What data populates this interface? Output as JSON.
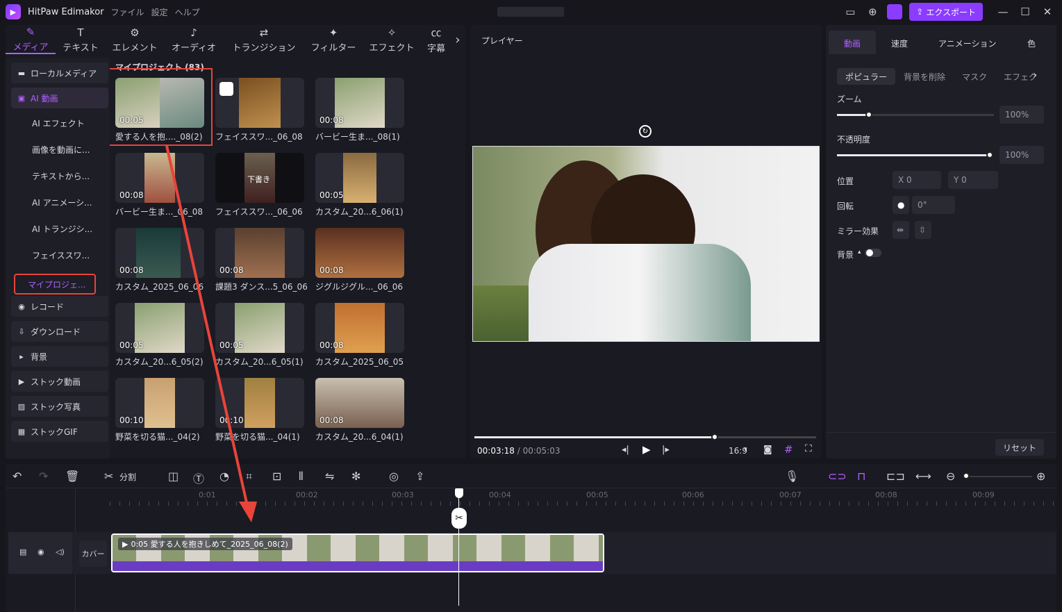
{
  "app": {
    "name": "HitPaw Edimakor",
    "menus": [
      "ファイル",
      "設定",
      "ヘルプ"
    ],
    "export_label": "エクスポート"
  },
  "tabs": [
    {
      "label": "メディア",
      "icon": "media-icon"
    },
    {
      "label": "テキスト",
      "icon": "text-icon"
    },
    {
      "label": "エレメント",
      "icon": "element-icon"
    },
    {
      "label": "オーディオ",
      "icon": "audio-icon"
    },
    {
      "label": "トランジション",
      "icon": "transition-icon"
    },
    {
      "label": "フィルター",
      "icon": "filter-icon"
    },
    {
      "label": "エフェクト",
      "icon": "effect-icon"
    },
    {
      "label": "字幕",
      "icon": "subtitle-icon"
    }
  ],
  "sidebar": {
    "items": [
      {
        "label": "ローカルメディア"
      },
      {
        "label": "AI 動画"
      },
      {
        "label": "AI エフェクト"
      },
      {
        "label": "画像を動画に..."
      },
      {
        "label": "テキストから..."
      },
      {
        "label": "AI アニメーシ..."
      },
      {
        "label": "AI トランジシ..."
      },
      {
        "label": "フェイススワ..."
      },
      {
        "label": "マイプロジェ..."
      },
      {
        "label": "レコード"
      },
      {
        "label": "ダウンロード"
      },
      {
        "label": "背景"
      },
      {
        "label": "ストック動画"
      },
      {
        "label": "ストック写真"
      },
      {
        "label": "ストックGIF"
      }
    ]
  },
  "grid": {
    "title": "マイプロジェクト (83)",
    "items": [
      {
        "duration": "00:05",
        "caption": "愛する人を抱...._08(2)"
      },
      {
        "duration": "",
        "caption": "フェイススワ..._06_08"
      },
      {
        "duration": "00:08",
        "caption": "バービー生ま..._08(1)"
      },
      {
        "duration": "00:08",
        "caption": "バービー生ま..._06_08"
      },
      {
        "duration": "",
        "caption": "フェイススワ..._06_06",
        "overlay": "下書き"
      },
      {
        "duration": "00:05",
        "caption": "カスタム_20...6_06(1)"
      },
      {
        "duration": "00:08",
        "caption": "カスタム_2025_06_06"
      },
      {
        "duration": "00:08",
        "caption": "課題3 ダンス...5_06_06"
      },
      {
        "duration": "00:08",
        "caption": "ジグルジグル..._06_06"
      },
      {
        "duration": "00:05",
        "caption": "カスタム_20...6_05(2)"
      },
      {
        "duration": "00:05",
        "caption": "カスタム_20...6_05(1)"
      },
      {
        "duration": "00:08",
        "caption": "カスタム_2025_06_05"
      },
      {
        "duration": "00:10",
        "caption": "野菜を切る猫..._04(2)"
      },
      {
        "duration": "00:10",
        "caption": "野菜を切る猫..._04(1)"
      },
      {
        "duration": "00:08",
        "caption": "カスタム_20...6_04(1)"
      }
    ]
  },
  "player": {
    "title": "プレイヤー",
    "time_current": "00:03:18",
    "time_total": "00:05:03",
    "progress": 0.655,
    "aspect": "16:9"
  },
  "props": {
    "tabs": [
      "動画",
      "速度",
      "アニメーション",
      "色"
    ],
    "subtabs": [
      "ポピュラー",
      "背景を削除",
      "マスク",
      "エフェク"
    ],
    "zoom_label": "ズーム",
    "zoom_value": "100%",
    "opacity_label": "不透明度",
    "opacity_value": "100%",
    "position_label": "位置",
    "pos_x": "X  0",
    "pos_y": "Y  0",
    "rotate_label": "回転",
    "rotate_value": "0°",
    "mirror_label": "ミラー効果",
    "bg_label": "背景",
    "reset_label": "リセット"
  },
  "timeline": {
    "split_label": "分割",
    "ruler": [
      "0:01",
      "00:02",
      "00:03",
      "00:04",
      "00:05",
      "00:06",
      "00:07",
      "00:08",
      "00:09"
    ],
    "cover_label": "カバー",
    "clip_label": "0:05 愛する人を抱きしめて_2025_06_08(2)"
  },
  "colors": {
    "accent": "#b060ff",
    "highlight": "#e8443a",
    "clip": "#6a3cc4"
  }
}
